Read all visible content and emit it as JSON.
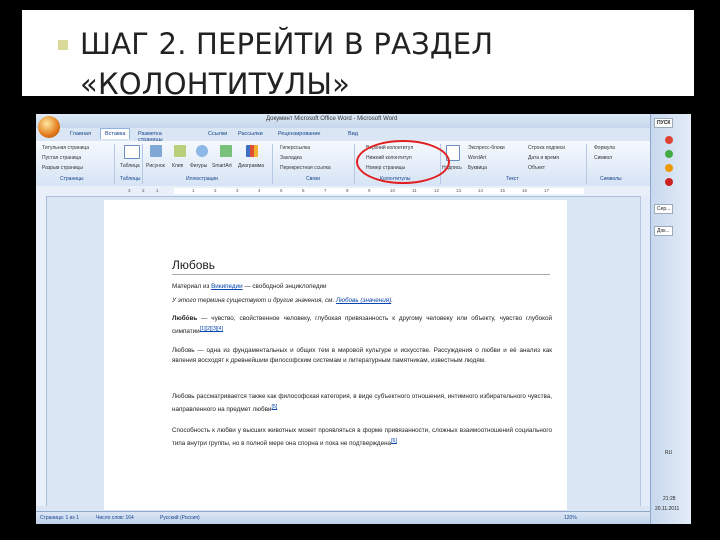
{
  "slide": {
    "title_line1": "ШАГ 2. ПЕРЕЙТИ В РАЗДЕЛ",
    "title_line2": "«КОЛОНТИТУЛЫ»",
    "bullet_color": "#d9d99a"
  },
  "word": {
    "window_title": "Документ Microsoft Office Word - Microsoft Word",
    "tabs": [
      "Главная",
      "Вставка",
      "Разметка страницы",
      "Ссылки",
      "Рассылки",
      "Рецензирование",
      "Вид"
    ],
    "active_tab": "Вставка",
    "ribbon": {
      "pages_group": {
        "items": [
          "Титульная страница",
          "Пустая страница",
          "Разрыв страницы"
        ],
        "label": "Страницы"
      },
      "tables_group": {
        "items": [
          "Таблица"
        ],
        "label": "Таблицы"
      },
      "illustrations_group": {
        "items": [
          "Рисунок",
          "Клип",
          "Фигуры",
          "SmartArt",
          "Диаграмма"
        ],
        "label": "Иллюстрации"
      },
      "links_group": {
        "items": [
          "Гиперссылка",
          "Закладка",
          "Перекрестная ссылка"
        ],
        "label": "Связи"
      },
      "header_footer_group": {
        "items": [
          "Верхний колонтитул",
          "Нижний колонтитул",
          "Номер страницы"
        ],
        "label": "Колонтитулы"
      },
      "text_group": {
        "items": [
          "Надпись",
          "Экспресс-блоки",
          "WordArt",
          "Буквица",
          "Строка подписи",
          "Дата и время",
          "Объект"
        ],
        "label": "Текст"
      },
      "symbols_group": {
        "items": [
          "Формула",
          "Символ"
        ],
        "label": "Символы"
      }
    },
    "ruler_numbers": [
      "3",
      "2",
      "1",
      "1",
      "2",
      "3",
      "4",
      "5",
      "6",
      "7",
      "8",
      "9",
      "10",
      "11",
      "12",
      "13",
      "14",
      "15",
      "16",
      "17"
    ],
    "document": {
      "heading": "Любовь",
      "source_prefix": "Материал из ",
      "source_link": "Википедии",
      "source_suffix": " — свободной энциклопедии",
      "disambig_prefix": "У этого термина существуют и другие значения, см. ",
      "disambig_link": "Любовь (значения)",
      "disambig_suffix": ".",
      "para1_bold": "Любо́вь",
      "para1_rest": " — чувство, свойственное человеку, глубокая привязанность к другому человеку или объекту, чувство глубокой симпатии",
      "para1_refs": "[1][2][3][4]",
      "para2": "Любовь — одна из фундаментальных и общих тем в мировой культуре и искусстве. Рассуждения о любви и её анализ как явления восходят к древнейшим философским системам и литературным памятникам, известным людям.",
      "para3": "Любовь рассматривается также как философская категория, в виде субъектного отношения, интимного избирательного чувства, направленного на предмет любви",
      "para3_ref": "[5]",
      "para4": "Способность к любви у высших животных может проявляться в форме привязанности, сложных взаимоотношений социального типа внутри группы, но в полной мере она спорна и пока не подтверждена",
      "para4_ref": "[6]"
    },
    "status": {
      "page": "Страница: 1 из 1",
      "words": "Число слов: 164",
      "language": "Русский (Россия)",
      "zoom": "120%"
    }
  },
  "taskbar": {
    "button1": "ПУСК",
    "button2": "Сер...",
    "button3": "Док...",
    "lang": "RU",
    "time": "21:28",
    "date": "20.11.2011"
  }
}
